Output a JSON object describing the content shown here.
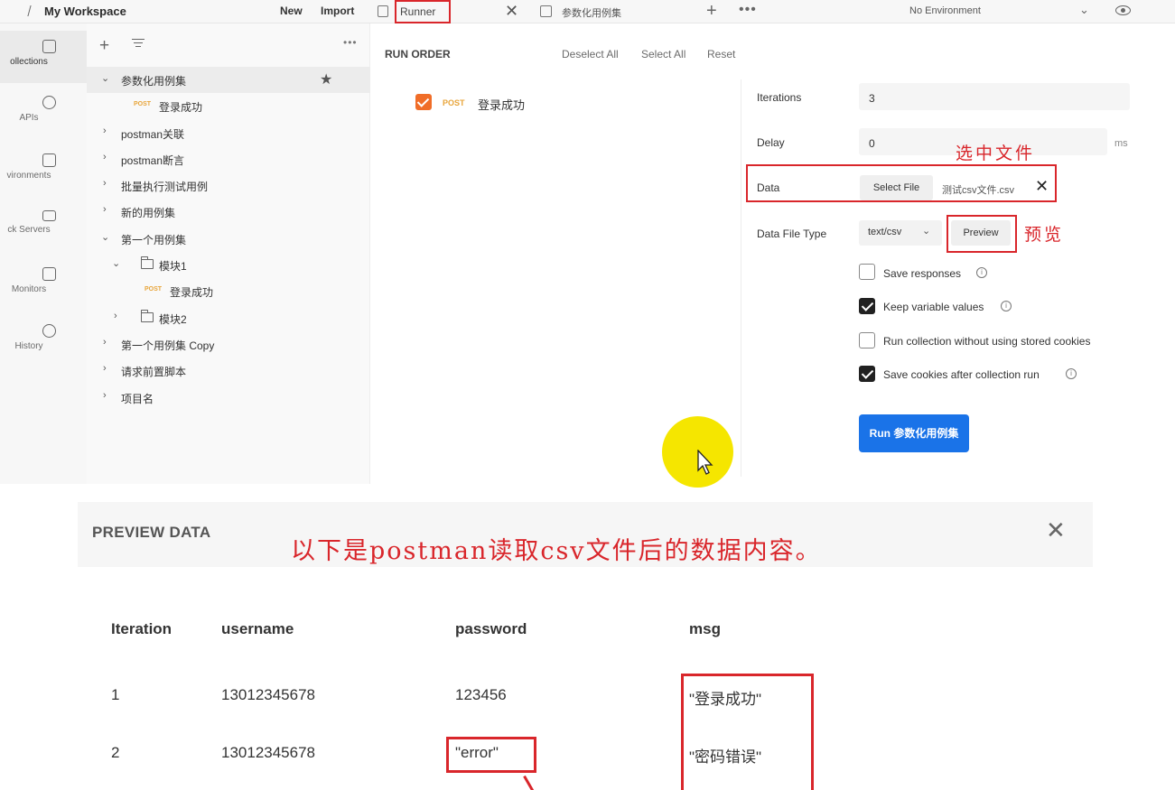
{
  "topbar": {
    "workspace": "My Workspace",
    "new_label": "New",
    "import_label": "Import",
    "tabs": [
      {
        "label": "Runner"
      },
      {
        "label": "参数化用例集"
      }
    ],
    "environment": "No Environment"
  },
  "rail": [
    {
      "label": "ollections",
      "icon": "collections-icon"
    },
    {
      "label": "APIs",
      "icon": "apis-icon"
    },
    {
      "label": "vironments",
      "icon": "environments-icon"
    },
    {
      "label": "ck Servers",
      "icon": "mock-servers-icon"
    },
    {
      "label": "Monitors",
      "icon": "monitors-icon"
    },
    {
      "label": "History",
      "icon": "history-icon"
    }
  ],
  "tree": [
    {
      "label": "参数化用例集"
    },
    {
      "method": "POST",
      "label": "登录成功"
    },
    {
      "label": "postman关联"
    },
    {
      "label": "postman断言"
    },
    {
      "label": "批量执行测试用例"
    },
    {
      "label": "新的用例集"
    },
    {
      "label": "第一个用例集"
    },
    {
      "label": "模块1"
    },
    {
      "method": "POST",
      "label": "登录成功"
    },
    {
      "label": "模块2"
    },
    {
      "label": "第一个用例集 Copy"
    },
    {
      "label": "请求前置脚本"
    },
    {
      "label": "项目名"
    }
  ],
  "runner": {
    "run_order": "RUN ORDER",
    "deselect_all": "Deselect All",
    "select_all": "Select All",
    "reset": "Reset",
    "request": {
      "method": "POST",
      "name": "登录成功",
      "checked": true
    },
    "iterations_label": "Iterations",
    "iterations_value": "3",
    "delay_label": "Delay",
    "delay_value": "0",
    "delay_unit": "ms",
    "data_label": "Data",
    "select_file": "Select File",
    "file_name": "测试csv文件.csv",
    "data_file_type_label": "Data File Type",
    "data_file_type": "text/csv",
    "preview_button": "Preview",
    "options": [
      {
        "label": "Save responses",
        "checked": false,
        "info": true
      },
      {
        "label": "Keep variable values",
        "checked": true,
        "info": true
      },
      {
        "label": "Run collection without using stored cookies",
        "checked": false,
        "info": false
      },
      {
        "label": "Save cookies after collection run",
        "checked": true,
        "info": true
      }
    ],
    "run_button": "Run 参数化用例集"
  },
  "annotations": {
    "select_file_note": "选中文件",
    "preview_note": "预览",
    "preview_panel_note": "以下是postman读取csv文件后的数据内容。"
  },
  "preview": {
    "title": "PREVIEW DATA",
    "columns": [
      "Iteration",
      "username",
      "password",
      "msg"
    ],
    "rows": [
      [
        "1",
        "13012345678",
        "123456",
        "\"登录成功\""
      ],
      [
        "2",
        "13012345678",
        "\"error\"",
        "\"密码错误\""
      ]
    ]
  },
  "colors": {
    "accent": "#1a73e8",
    "annotation": "#d9262b",
    "post_method": "#e8a53a",
    "checkbox_orange": "#f06d28",
    "cursor_highlight": "#f5e600"
  }
}
